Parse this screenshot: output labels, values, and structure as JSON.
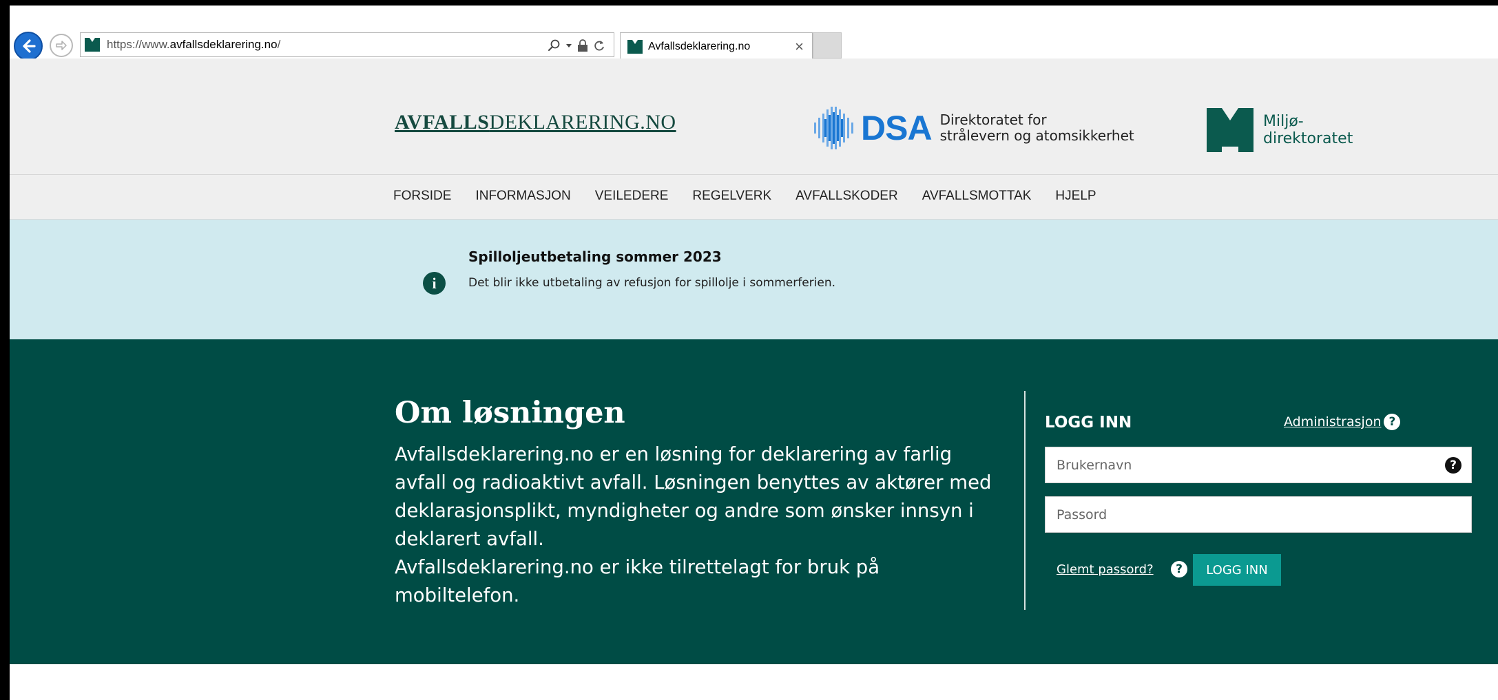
{
  "browser": {
    "url_prefix": "https://www.",
    "url_domain": "avfallsdeklarering.no",
    "url_suffix": "/",
    "tab_title": "Avfallsdeklarering.no",
    "tab_close": "×"
  },
  "header": {
    "logo_bold": "AVFALLS",
    "logo_rest": "DEKLARERING.NO",
    "dsa_abbr": "DSA",
    "dsa_name_line1": "Direktoratet for",
    "dsa_name_line2": "strålevern og atomsikkerhet",
    "md_name_line1": "Miljø-",
    "md_name_line2": "direktoratet"
  },
  "nav": {
    "items": [
      "FORSIDE",
      "INFORMASJON",
      "VEILEDERE",
      "REGELVERK",
      "AVFALLSKODER",
      "AVFALLSMOTTAK",
      "HJELP"
    ]
  },
  "notice": {
    "icon_glyph": "i",
    "title": "Spilloljeutbetaling sommer 2023",
    "text": "Det blir ikke utbetaling av refusjon for spillolje i sommerferien."
  },
  "about": {
    "title": "Om løsningen",
    "paragraph1": "Avfallsdeklarering.no er en løsning for deklarering av farlig avfall og radioaktivt avfall. Løsningen benyttes av aktører med deklarasjonsplikt, myndigheter og andre som ønsker innsyn i deklarert avfall.",
    "paragraph2": "Avfallsdeklarering.no er ikke tilrettelagt for bruk på mobiltelefon."
  },
  "login": {
    "heading": "LOGG INN",
    "admin_link": "Administrasjon",
    "username_placeholder": "Brukernavn",
    "password_placeholder": "Passord",
    "forgot_link": "Glemt passord?",
    "submit_label": "LOGG INN",
    "help_glyph": "?"
  },
  "colors": {
    "brand_green": "#004c45",
    "accent_teal": "#0b9a91",
    "notice_bg": "#d0eaef",
    "header_bg": "#efefef",
    "dsa_blue": "#1976d2"
  },
  "icons": [
    "back-arrow-icon",
    "forward-arrow-icon",
    "site-favicon-icon",
    "search-icon",
    "dropdown-icon",
    "lock-icon",
    "refresh-icon",
    "info-icon",
    "help-icon"
  ]
}
